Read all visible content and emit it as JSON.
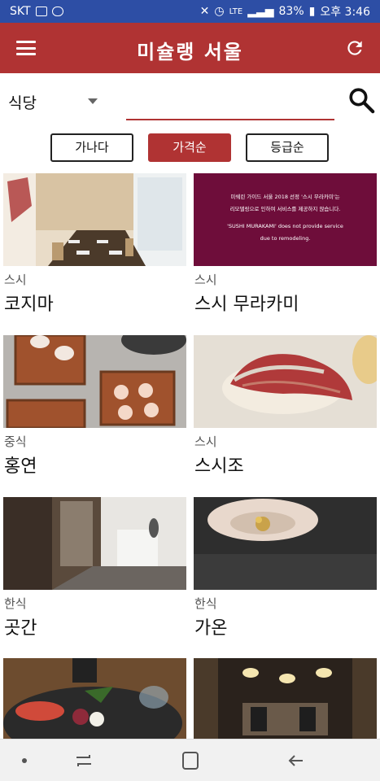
{
  "status_bar": {
    "carrier": "SKT",
    "battery": "83%",
    "network": "LTE",
    "time": "오후 3:46"
  },
  "app_bar": {
    "title": "미슐랭 서울",
    "menu_icon": "hamburger-icon",
    "refresh_icon": "refresh-icon"
  },
  "search": {
    "category": "식당",
    "placeholder": "",
    "value": ""
  },
  "sort": {
    "buttons": [
      "가나다",
      "가격순",
      "등급순"
    ],
    "active": "가격순"
  },
  "notice": {
    "line1": "미쉐린 가이드 서울 2018 선정 '스시 무라카미'는",
    "line2": "리모델링으로 인하여 서비스를 제공하지 않습니다.",
    "line3": "'SUSHI MURAKAMI' does not provide service",
    "line4": "due to remodeling."
  },
  "restaurants": [
    {
      "category": "스시",
      "name": "코지마"
    },
    {
      "category": "스시",
      "name": "스시 무라카미"
    },
    {
      "category": "중식",
      "name": "홍연"
    },
    {
      "category": "스시",
      "name": "스시조"
    },
    {
      "category": "한식",
      "name": "곳간"
    },
    {
      "category": "한식",
      "name": "가온"
    },
    {
      "category": "",
      "name": ""
    },
    {
      "category": "",
      "name": ""
    }
  ],
  "colors": {
    "primary": "#b03333",
    "status_bar": "#2d4ea5",
    "notice_bg": "#6e0d3a"
  }
}
